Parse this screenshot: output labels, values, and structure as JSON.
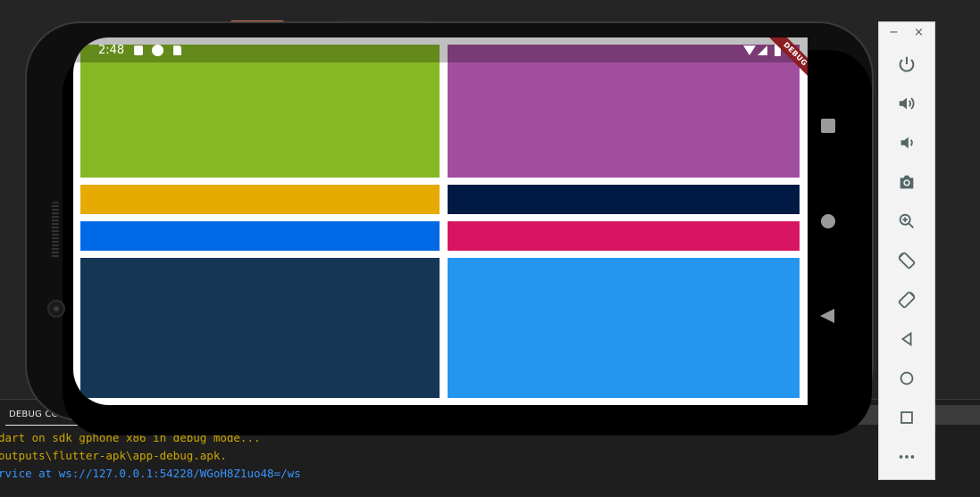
{
  "debug_panel": {
    "tab_label": "DEBUG CO",
    "console_lines": [
      "dart on sdk gphone x86 in debug mode...",
      "outputs\\flutter-apk\\app-debug.apk.",
      "rvice at ws://127.0.0.1:54228/WGoH8Z1uo48=/ws"
    ]
  },
  "status_bar": {
    "time": "2:48",
    "debug_banner": "DEBUG"
  },
  "tiles": [
    {
      "name": "green-tile",
      "color": "#86b825"
    },
    {
      "name": "purple-tile",
      "color": "#a14f9e"
    },
    {
      "name": "amber-tile",
      "color": "#e6aa00"
    },
    {
      "name": "navy-tile",
      "color": "#001a45"
    },
    {
      "name": "blue-tile",
      "color": "#0069e6"
    },
    {
      "name": "pink-tile",
      "color": "#d71562"
    },
    {
      "name": "dark-blue-tile",
      "color": "#163655"
    },
    {
      "name": "light-blue-tile",
      "color": "#2596f0"
    }
  ],
  "toolbar": {
    "minimize_glyph": "−",
    "close_glyph": "×",
    "buttons": [
      {
        "icon": "power-icon"
      },
      {
        "icon": "volume-up-icon"
      },
      {
        "icon": "volume-down-icon"
      },
      {
        "icon": "camera-icon"
      },
      {
        "icon": "zoom-icon"
      },
      {
        "icon": "rotate-left-icon"
      },
      {
        "icon": "rotate-right-icon"
      },
      {
        "icon": "back-icon"
      },
      {
        "icon": "home-icon"
      },
      {
        "icon": "overview-icon"
      },
      {
        "icon": "more-icon"
      }
    ]
  }
}
